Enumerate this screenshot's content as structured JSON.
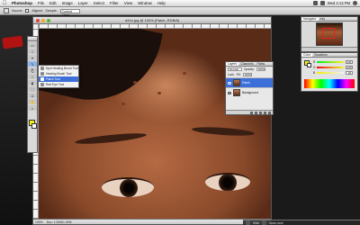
{
  "menubar": {
    "apple": "",
    "items": [
      "Photoshop",
      "File",
      "Edit",
      "Image",
      "Layer",
      "Select",
      "Filter",
      "View",
      "Window",
      "Help"
    ],
    "clock": "Wed 2:13 PM"
  },
  "optionsbar": {
    "sample_label": "Sample:",
    "sample_value": "Current Layer",
    "aligned_label": "Aligned",
    "source_label": "Source:"
  },
  "document": {
    "title": "d41e.jpg @ 100% (Patch, RGB/8)",
    "status_zoom": "100%",
    "status_doc": "Doc: 1.32M/1.32M"
  },
  "tools": {
    "glyphs": [
      "▭",
      "⊹",
      "⌖",
      "✎",
      "⎗",
      "✧",
      "▮",
      "⛶",
      "A",
      "✋",
      "⌕"
    ]
  },
  "flyout": {
    "items": [
      {
        "label": "Spot Healing Brush Tool",
        "selected": false
      },
      {
        "label": "Healing Brush Tool",
        "selected": false
      },
      {
        "label": "Patch Tool",
        "selected": true
      },
      {
        "label": "Red Eye Tool",
        "selected": false
      }
    ]
  },
  "layers": {
    "tabs": [
      "Layers",
      "Channels",
      "Paths"
    ],
    "blend_mode": "Normal",
    "opacity_label": "Opacity:",
    "opacity_value": "100%",
    "lock_label": "Lock:",
    "fill_label": "Fill:",
    "fill_value": "100%",
    "items": [
      {
        "name": "Patch",
        "selected": true
      },
      {
        "name": "Background",
        "selected": false
      }
    ]
  },
  "navigator": {
    "tabs": [
      "Navigator",
      "Info"
    ]
  },
  "color": {
    "tabs": [
      "Color",
      "Swatches"
    ],
    "sliders": [
      {
        "label": "R",
        "value": "242",
        "gradient": "linear-gradient(90deg,#00ef1a,#ffef1a)"
      },
      {
        "label": "G",
        "value": "239",
        "gradient": "linear-gradient(90deg,#f2001a,#f2ff1a)"
      },
      {
        "label": "B",
        "value": "26",
        "gradient": "linear-gradient(90deg,#f2ef00,#f2efff)"
      }
    ],
    "foreground": "#f2ef1a",
    "background": "#ffffff"
  },
  "dock": {
    "items": [
      "Hitch",
      "show none"
    ]
  }
}
